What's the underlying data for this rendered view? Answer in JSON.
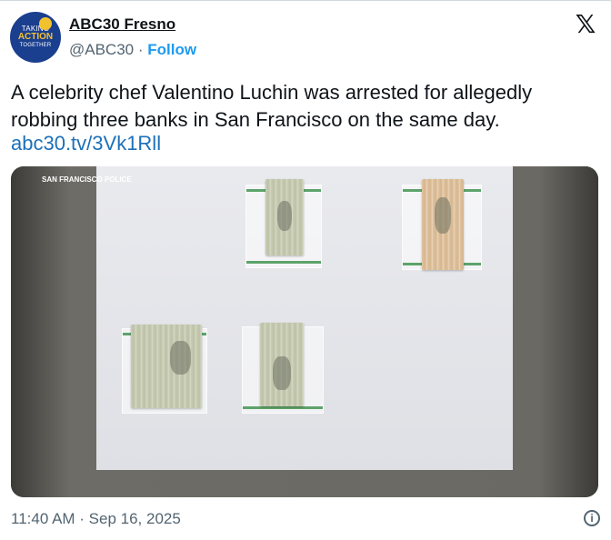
{
  "author": {
    "name": "ABC30 Fresno",
    "handle": "@ABC30",
    "separator": " · ",
    "follow_label": "Follow",
    "avatar_text": [
      "TAKING",
      "ACTION",
      "TOGETHER"
    ]
  },
  "tweet": {
    "text": "A celebrity chef Valentino Luchin was arrested for allegedly robbing three banks in San Francisco on the same day.",
    "link": "abc30.tv/3Vk1Rll"
  },
  "media": {
    "watermark": "SAN FRANCISCO POLICE"
  },
  "footer": {
    "timestamp": "11:40 AM · Sep 16, 2025",
    "info_glyph": "i"
  },
  "icons": {
    "x_logo": "x-logo-icon",
    "info": "info-icon"
  },
  "colors": {
    "link": "#1d9bf0",
    "brand_blue": "#1b3f8f",
    "brand_gold": "#f2c12e",
    "secondary_text": "#536471"
  }
}
